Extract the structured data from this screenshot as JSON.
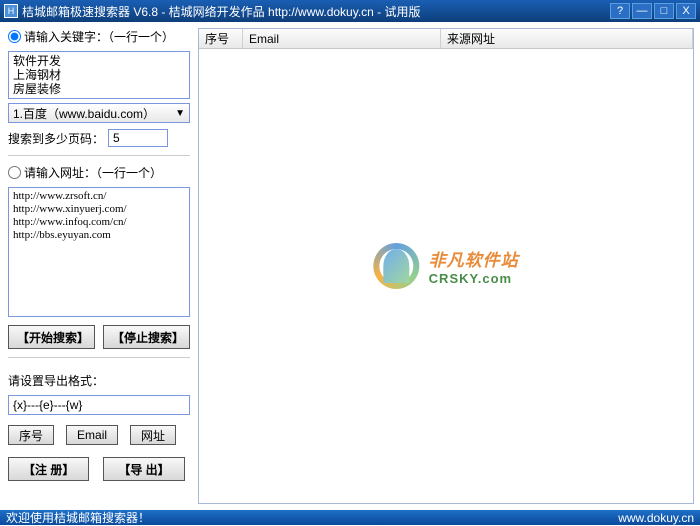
{
  "titlebar": {
    "app_icon": "H",
    "title": "桔城邮箱极速搜索器 V6.8 - 桔城网络开发作品 http://www.dokuy.cn  - 试用版",
    "help": "?",
    "min": "—",
    "max": "□",
    "close": "X"
  },
  "left": {
    "keyword_label": "请输入关键字：（一行一个）",
    "keywords": [
      "软件开发",
      "上海钢材",
      "房屋装修"
    ],
    "engine_selected": "1.百度（www.baidu.com）",
    "page_label": "搜索到多少页码：",
    "page_value": "5",
    "url_label": "请输入网址：（一行一个）",
    "urls": [
      "http://www.zrsoft.cn/",
      "http://www.xinyuerj.com/",
      "http://www.infoq.com/cn/",
      "http://bbs.eyuyan.com"
    ],
    "start_btn": "【开始搜索】",
    "stop_btn": "【停止搜索】",
    "format_label": "请设置导出格式：",
    "format_value": "{x}---{e}---{w}",
    "exp_seq": "序号",
    "exp_email": "Email",
    "exp_url": "网址",
    "register_btn": "【注  册】",
    "export_btn": "【导  出】"
  },
  "table": {
    "col_seq": "序号",
    "col_email": "Email",
    "col_src": "来源网址"
  },
  "watermark": {
    "cn": "非凡软件站",
    "en": "CRSKY.com"
  },
  "statusbar": {
    "welcome": "欢迎使用桔城邮箱搜索器！",
    "url": "www.dokuy.cn"
  }
}
